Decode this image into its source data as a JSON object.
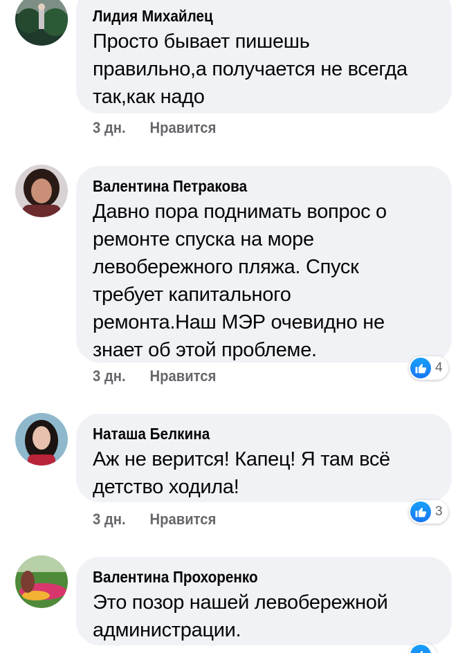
{
  "comments": [
    {
      "author": "Лидия Михайлец",
      "lines": [
        "Просто бывает пишешь",
        "правильно,а получается не всегда",
        "так,как надо"
      ],
      "time": "3 дн.",
      "like_label": "Нравится",
      "reaction_count": null
    },
    {
      "author": "Валентина Петракова",
      "lines": [
        "Давно пора поднимать вопрос о",
        "ремонте спуска на море",
        "левобережного пляжа. Спуск",
        "требует капитального",
        "ремонта.Наш МЭР очевидно не",
        "знает об этой проблеме."
      ],
      "time": "3 дн.",
      "like_label": "Нравится",
      "reaction_count": "4"
    },
    {
      "author": "Наташа Белкина",
      "lines": [
        "Аж не верится! Капец! Я там всё",
        "детство ходила!"
      ],
      "time": "3 дн.",
      "like_label": "Нравится",
      "reaction_count": "3"
    },
    {
      "author": "Валентина Прохоренко",
      "lines": [
        "Это позор нашей левобережной",
        "администрации."
      ],
      "time": "",
      "like_label": "",
      "reaction_count": ""
    }
  ],
  "icons": {
    "reaction": "like-icon",
    "like_color": "#1877f2"
  }
}
